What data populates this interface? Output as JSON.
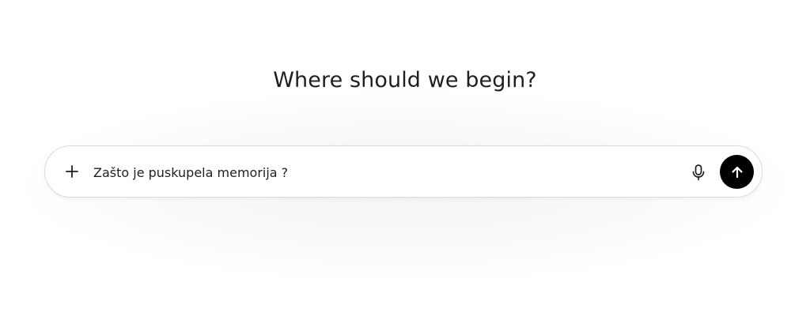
{
  "main": {
    "headline": "Where should we begin?"
  },
  "composer": {
    "input_value": "Zašto je puskupela memorija ?",
    "icons": {
      "add": "plus-icon",
      "voice": "microphone-icon",
      "send": "arrow-up-icon"
    },
    "colors": {
      "send_button_bg": "#000000",
      "send_icon": "#ffffff",
      "text": "#1f1f1f"
    }
  }
}
